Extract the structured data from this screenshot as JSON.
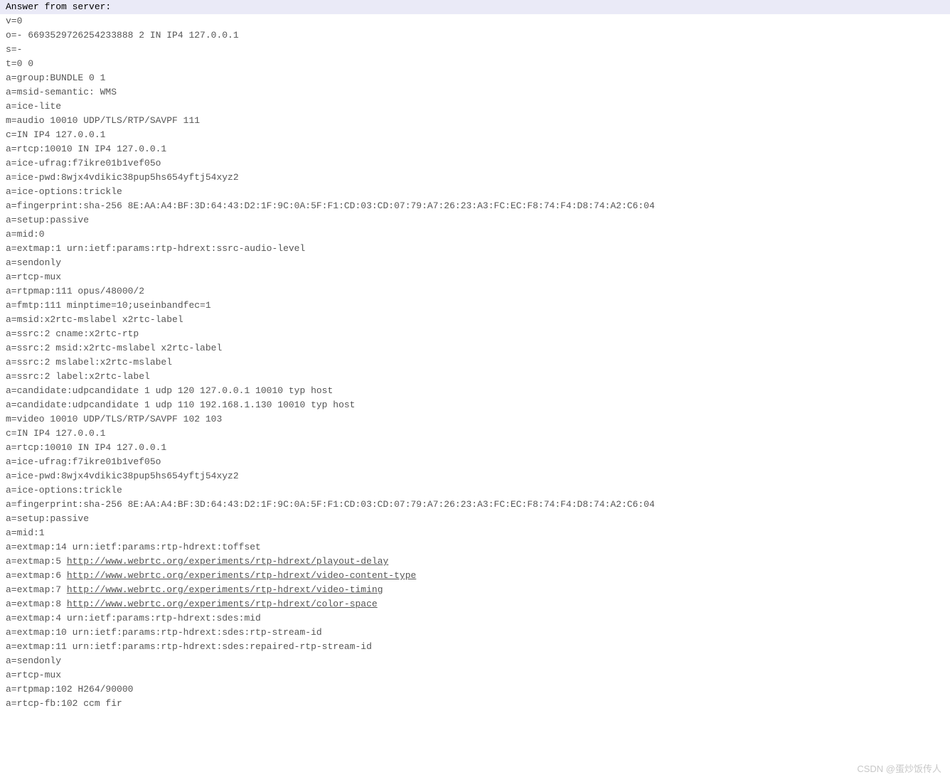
{
  "header": "Answer from server:",
  "lines": [
    "v=0",
    "o=- 6693529726254233888 2 IN IP4 127.0.0.1",
    "s=-",
    "t=0 0",
    "a=group:BUNDLE 0 1",
    "a=msid-semantic: WMS",
    "a=ice-lite",
    "m=audio 10010 UDP/TLS/RTP/SAVPF 111",
    "c=IN IP4 127.0.0.1",
    "a=rtcp:10010 IN IP4 127.0.0.1",
    "a=ice-ufrag:f7ikre01b1vef05o",
    "a=ice-pwd:8wjx4vdikic38pup5hs654yftj54xyz2",
    "a=ice-options:trickle",
    "a=fingerprint:sha-256 8E:AA:A4:BF:3D:64:43:D2:1F:9C:0A:5F:F1:CD:03:CD:07:79:A7:26:23:A3:FC:EC:F8:74:F4:D8:74:A2:C6:04",
    "a=setup:passive",
    "a=mid:0",
    "a=extmap:1 urn:ietf:params:rtp-hdrext:ssrc-audio-level",
    "a=sendonly",
    "a=rtcp-mux",
    "a=rtpmap:111 opus/48000/2",
    "a=fmtp:111 minptime=10;useinbandfec=1",
    "a=msid:x2rtc-mslabel x2rtc-label",
    "a=ssrc:2 cname:x2rtc-rtp",
    "a=ssrc:2 msid:x2rtc-mslabel x2rtc-label",
    "a=ssrc:2 mslabel:x2rtc-mslabel",
    "a=ssrc:2 label:x2rtc-label",
    "a=candidate:udpcandidate 1 udp 120 127.0.0.1 10010 typ host",
    "a=candidate:udpcandidate 1 udp 110 192.168.1.130 10010 typ host",
    "m=video 10010 UDP/TLS/RTP/SAVPF 102 103",
    "c=IN IP4 127.0.0.1",
    "a=rtcp:10010 IN IP4 127.0.0.1",
    "a=ice-ufrag:f7ikre01b1vef05o",
    "a=ice-pwd:8wjx4vdikic38pup5hs654yftj54xyz2",
    "a=ice-options:trickle",
    "a=fingerprint:sha-256 8E:AA:A4:BF:3D:64:43:D2:1F:9C:0A:5F:F1:CD:03:CD:07:79:A7:26:23:A3:FC:EC:F8:74:F4:D8:74:A2:C6:04",
    "a=setup:passive",
    "a=mid:1",
    "a=extmap:14 urn:ietf:params:rtp-hdrext:toffset"
  ],
  "linked_lines": [
    {
      "prefix": "a=extmap:5 ",
      "url": "http://www.webrtc.org/experiments/rtp-hdrext/playout-delay"
    },
    {
      "prefix": "a=extmap:6 ",
      "url": "http://www.webrtc.org/experiments/rtp-hdrext/video-content-type"
    },
    {
      "prefix": "a=extmap:7 ",
      "url": "http://www.webrtc.org/experiments/rtp-hdrext/video-timing"
    },
    {
      "prefix": "a=extmap:8 ",
      "url": "http://www.webrtc.org/experiments/rtp-hdrext/color-space"
    }
  ],
  "tail_lines": [
    "a=extmap:4 urn:ietf:params:rtp-hdrext:sdes:mid",
    "a=extmap:10 urn:ietf:params:rtp-hdrext:sdes:rtp-stream-id",
    "a=extmap:11 urn:ietf:params:rtp-hdrext:sdes:repaired-rtp-stream-id",
    "a=sendonly",
    "a=rtcp-mux",
    "a=rtpmap:102 H264/90000",
    "a=rtcp-fb:102 ccm fir"
  ],
  "watermark": "CSDN @蛋炒饭传人"
}
